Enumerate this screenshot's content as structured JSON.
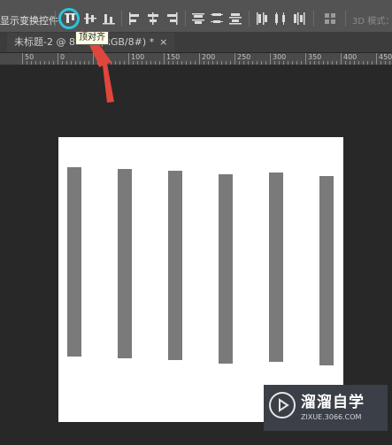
{
  "options_bar": {
    "transform_label": "显示变换控件",
    "mode_3d": "3D 模式："
  },
  "tooltip": "顶对齐",
  "tab": {
    "title": "未标题-2 @ 80.3%(RGB/8#) *",
    "close": "×"
  },
  "ruler": {
    "labels": [
      "50",
      "0",
      "50",
      "100",
      "150",
      "200",
      "250",
      "300",
      "350",
      "400",
      "450"
    ]
  },
  "canvas": {
    "bar_color": "#7a7a7a",
    "background": "#ffffff"
  },
  "watermark": {
    "title": "溜溜自学",
    "url": "ZIXUE.3066.COM"
  },
  "colors": {
    "highlight_ring": "#2ec4d8",
    "arrow": "#e0463c",
    "tooltip_bg": "#ffffe6"
  },
  "icons": [
    "align-top-edges-icon",
    "align-vertical-centers-icon",
    "align-bottom-edges-icon",
    "align-left-edges-icon",
    "align-horizontal-centers-icon",
    "align-right-edges-icon",
    "distribute-top-icon",
    "distribute-vertical-centers-icon",
    "distribute-bottom-icon",
    "distribute-left-icon",
    "distribute-horizontal-centers-icon",
    "distribute-right-icon",
    "auto-align-layers-icon"
  ]
}
